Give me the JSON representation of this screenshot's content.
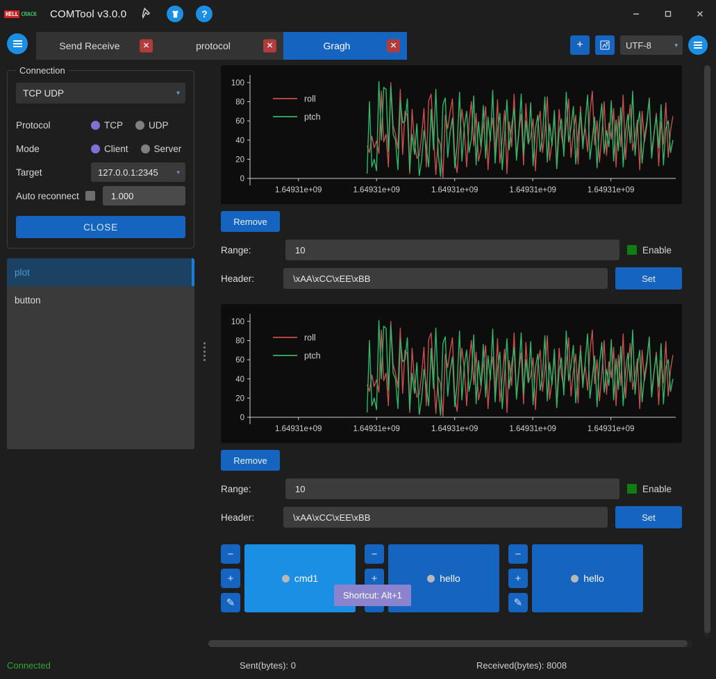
{
  "titlebar": {
    "logo_part1": "HELL",
    "logo_part2": "CRACK",
    "title": "COMTool v3.0.0",
    "pin_icon": "pin-icon",
    "shirt_icon": "shirt-icon",
    "help_icon": "help-icon",
    "help_glyph": "?",
    "minimize": "—",
    "maximize": "□",
    "close": "✕"
  },
  "tabbar": {
    "menu_icon": "hamburger-menu-icon",
    "tabs": [
      {
        "label": "Send Receive",
        "active": false,
        "close": "✕"
      },
      {
        "label": "protocol",
        "active": false,
        "close": "✕"
      },
      {
        "label": "Gragh",
        "active": true,
        "close": "✕"
      }
    ],
    "add_label": "+",
    "skin_icon": "skin-icon",
    "encoding": "UTF-8",
    "encoding_chevron": "▾",
    "options_icon": "options-menu-icon"
  },
  "connection": {
    "legend": "Connection",
    "type": "TCP UDP",
    "type_chevron": "▾",
    "protocol_label": "Protocol",
    "protocol_options": [
      {
        "label": "TCP",
        "selected": true
      },
      {
        "label": "UDP",
        "selected": false
      }
    ],
    "mode_label": "Mode",
    "mode_options": [
      {
        "label": "Client",
        "selected": true
      },
      {
        "label": "Server",
        "selected": false
      }
    ],
    "target_label": "Target",
    "target_value": "127.0.0.1:2345",
    "target_chevron": "▾",
    "auto_reconnect_label": "Auto reconnect",
    "auto_reconnect_checked": false,
    "auto_reconnect_interval": "1.000",
    "close_button": "CLOSE"
  },
  "plugin_list": {
    "items": [
      {
        "label": "plot",
        "selected": true
      },
      {
        "label": "button",
        "selected": false
      }
    ]
  },
  "plots": [
    {
      "remove_label": "Remove",
      "range_label": "Range:",
      "range_value": "10",
      "enable_label": "Enable",
      "enable_checked": true,
      "header_label": "Header:",
      "header_value": "\\xAA\\xCC\\xEE\\xBB",
      "set_label": "Set"
    },
    {
      "remove_label": "Remove",
      "range_label": "Range:",
      "range_value": "10",
      "enable_label": "Enable",
      "enable_checked": true,
      "header_label": "Header:",
      "header_value": "\\xAA\\xCC\\xEE\\xBB",
      "set_label": "Set"
    }
  ],
  "button_panel": {
    "groups": [
      {
        "minus": "−",
        "plus": "+",
        "edit_icon": "edit-icon",
        "edit_glyph": "✎",
        "label": "cmd1",
        "highlighted": true
      },
      {
        "minus": "−",
        "plus": "+",
        "edit_icon": "edit-icon",
        "edit_glyph": "✎",
        "label": "hello",
        "highlighted": false
      },
      {
        "minus": "−",
        "plus": "+",
        "edit_icon": "edit-icon",
        "edit_glyph": "✎",
        "label": "hello",
        "highlighted": false
      }
    ],
    "tooltip": "Shortcut: Alt+1"
  },
  "statusbar": {
    "connection_status": "Connected",
    "sent": "Sent(bytes): 0",
    "received": "Received(bytes): 8008"
  },
  "colors": {
    "accent_blue": "#1565c0",
    "bright_blue": "#1a8fe3",
    "series_roll": "#c94f4f",
    "series_ptch": "#2eb86a",
    "enable_green": "#117d11",
    "status_green": "#2fa82f",
    "tooltip_purple": "#8b83ce",
    "tab_close_red": "#b23b3b",
    "radio_selected": "#7b72d6"
  },
  "chart_data": {
    "type": "line",
    "title": "",
    "xlabel": "",
    "ylabel": "",
    "ylim": [
      0,
      105
    ],
    "yticks": [
      0,
      20,
      40,
      60,
      80,
      100
    ],
    "xticks": [
      "1.64931e+09",
      "1.64931e+09",
      "1.64931e+09",
      "1.64931e+09",
      "1.64931e+09"
    ],
    "grid": false,
    "legend_position": "upper-left-inside",
    "series": [
      {
        "name": "roll",
        "color": "#c94f4f",
        "values": [
          34,
          27,
          44,
          32,
          39,
          26,
          91,
          38,
          46,
          12,
          100,
          55,
          46,
          31,
          93,
          25,
          70,
          66,
          5,
          72,
          36,
          21,
          24,
          44,
          73,
          12,
          81,
          88,
          44,
          4,
          42,
          35,
          0,
          66,
          52,
          69,
          83,
          20,
          6,
          44,
          72,
          50,
          12,
          58,
          80,
          34,
          68,
          18,
          30,
          55,
          75,
          9,
          47,
          63,
          25,
          82,
          16,
          40,
          71,
          5,
          59,
          33,
          88,
          21,
          50,
          67,
          14,
          78,
          36,
          43,
          62,
          8,
          55,
          70,
          27,
          49,
          85,
          19,
          38,
          64,
          11,
          72,
          44,
          30,
          57,
          83,
          22,
          48,
          66,
          15,
          75,
          39,
          53,
          28,
          69,
          91,
          35,
          60,
          17,
          46,
          80,
          24,
          58,
          41,
          73,
          12,
          65,
          33,
          87,
          20,
          52,
          77,
          29,
          44,
          61,
          9,
          70,
          38,
          55,
          84,
          26,
          47,
          68,
          13,
          59,
          36,
          79,
          22,
          50,
          65
        ]
      },
      {
        "name": "ptch",
        "color": "#2eb86a",
        "values": [
          5,
          80,
          12,
          20,
          8,
          101,
          40,
          95,
          93,
          28,
          96,
          46,
          40,
          9,
          81,
          58,
          60,
          83,
          8,
          46,
          25,
          57,
          3,
          19,
          50,
          32,
          12,
          72,
          30,
          93,
          26,
          2,
          77,
          84,
          22,
          48,
          63,
          11,
          35,
          90,
          18,
          54,
          70,
          27,
          41,
          86,
          14,
          59,
          33,
          76,
          21,
          64,
          39,
          92,
          16,
          51,
          68,
          9,
          44,
          82,
          30,
          55,
          73,
          19,
          47,
          88,
          25,
          60,
          36,
          79,
          13,
          52,
          66,
          28,
          43,
          85,
          17,
          57,
          34,
          71,
          10,
          49,
          62,
          23,
          90,
          38,
          53,
          75,
          15,
          45,
          69,
          31,
          58,
          87,
          20,
          42,
          64,
          11,
          56,
          78,
          26,
          50,
          33,
          81,
          18,
          61,
          29,
          74,
          12,
          48,
          67,
          37,
          91,
          24,
          54,
          70,
          16,
          43,
          59,
          83,
          21,
          46,
          65,
          32,
          77,
          14,
          52,
          60,
          27,
          40
        ]
      }
    ]
  }
}
